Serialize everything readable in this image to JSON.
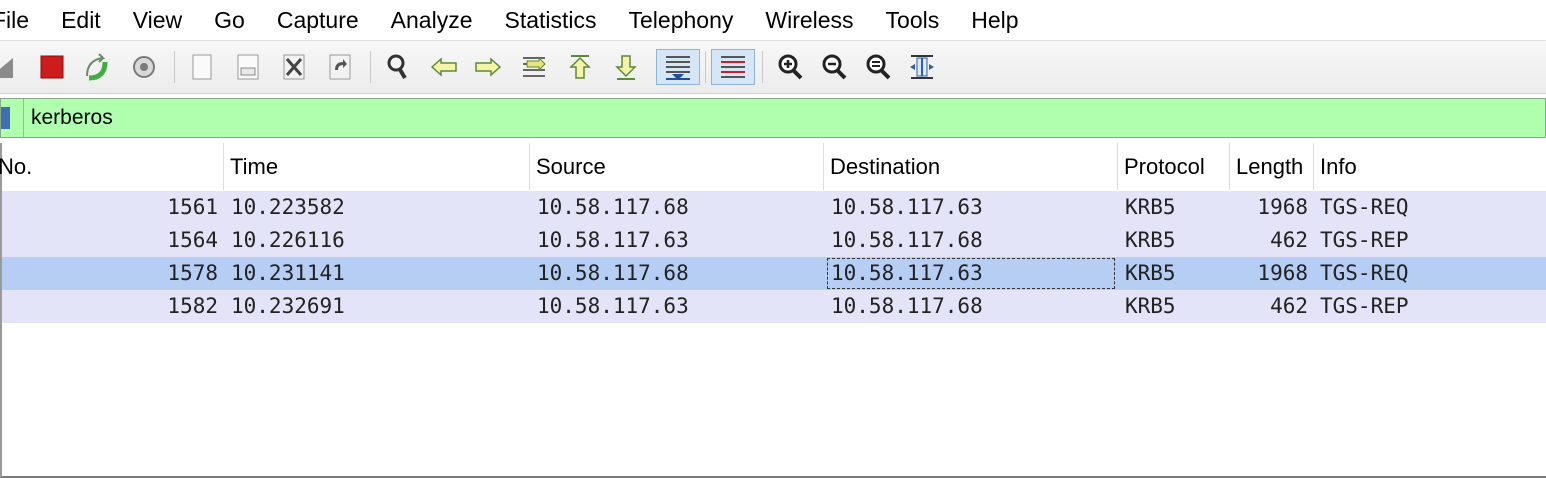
{
  "menu": [
    "File",
    "Edit",
    "View",
    "Go",
    "Capture",
    "Analyze",
    "Statistics",
    "Telephony",
    "Wireless",
    "Tools",
    "Help"
  ],
  "toolbar": {
    "buttons": [
      {
        "name": "start-capture-icon"
      },
      {
        "name": "stop-capture-icon"
      },
      {
        "name": "restart-capture-icon"
      },
      {
        "name": "capture-options-icon"
      },
      {
        "name": "open-file-icon"
      },
      {
        "name": "save-file-icon"
      },
      {
        "name": "close-file-icon"
      },
      {
        "name": "reload-file-icon"
      },
      {
        "name": "find-packet-icon"
      },
      {
        "name": "go-back-icon"
      },
      {
        "name": "go-forward-icon"
      },
      {
        "name": "go-to-packet-icon"
      },
      {
        "name": "go-first-packet-icon"
      },
      {
        "name": "go-last-packet-icon"
      },
      {
        "name": "autoscroll-icon"
      },
      {
        "name": "colorize-icon"
      },
      {
        "name": "zoom-in-icon"
      },
      {
        "name": "zoom-out-icon"
      },
      {
        "name": "zoom-normal-icon"
      },
      {
        "name": "resize-columns-icon"
      }
    ]
  },
  "filter": {
    "value": "kerberos"
  },
  "columns": [
    "No.",
    "Time",
    "Source",
    "Destination",
    "Protocol",
    "Length",
    "Info"
  ],
  "packets": [
    {
      "no": "1561",
      "time": "10.223582",
      "source": "10.58.117.68",
      "destination": "10.58.117.63",
      "protocol": "KRB5",
      "length": "1968",
      "info": "TGS-REQ"
    },
    {
      "no": "1564",
      "time": "10.226116",
      "source": "10.58.117.63",
      "destination": "10.58.117.68",
      "protocol": "KRB5",
      "length": "462",
      "info": "TGS-REP"
    },
    {
      "no": "1578",
      "time": "10.231141",
      "source": "10.58.117.68",
      "destination": "10.58.117.63",
      "protocol": "KRB5",
      "length": "1968",
      "info": "TGS-REQ"
    },
    {
      "no": "1582",
      "time": "10.232691",
      "source": "10.58.117.63",
      "destination": "10.58.117.68",
      "protocol": "KRB5",
      "length": "462",
      "info": "TGS-REP"
    }
  ],
  "selected_row": 2,
  "colors": {
    "filter_valid": "#afffaf",
    "row_background": "#e4e4f8",
    "row_selected": "#b6cdf4"
  }
}
